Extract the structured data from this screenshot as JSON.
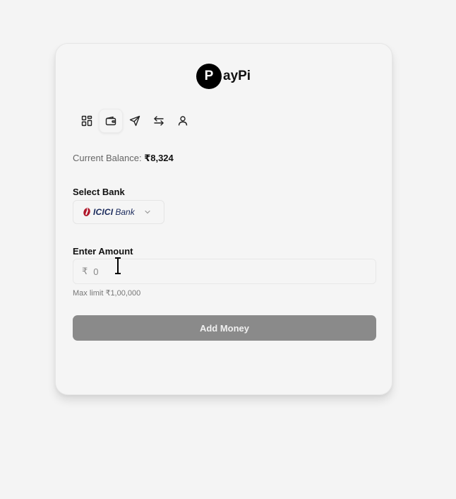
{
  "app": {
    "logo_letter": "P",
    "logo_text": "ayPi"
  },
  "nav": {
    "items": [
      {
        "icon": "dashboard-icon"
      },
      {
        "icon": "wallet-icon",
        "active": true
      },
      {
        "icon": "send-icon"
      },
      {
        "icon": "transfer-icon"
      },
      {
        "icon": "user-icon"
      }
    ]
  },
  "balance": {
    "label": "Current Balance:",
    "amount": "₹8,324"
  },
  "bank": {
    "label": "Select Bank",
    "selected_primary": "ICICI",
    "selected_secondary": "Bank"
  },
  "amount": {
    "label": "Enter Amount",
    "currency": "₹",
    "placeholder": "0",
    "max_limit": "Max limit ₹1,00,000"
  },
  "actions": {
    "add_money_label": "Add Money"
  },
  "colors": {
    "button_bg": "#8a8a8a",
    "bank_brand": "#b0172a"
  }
}
